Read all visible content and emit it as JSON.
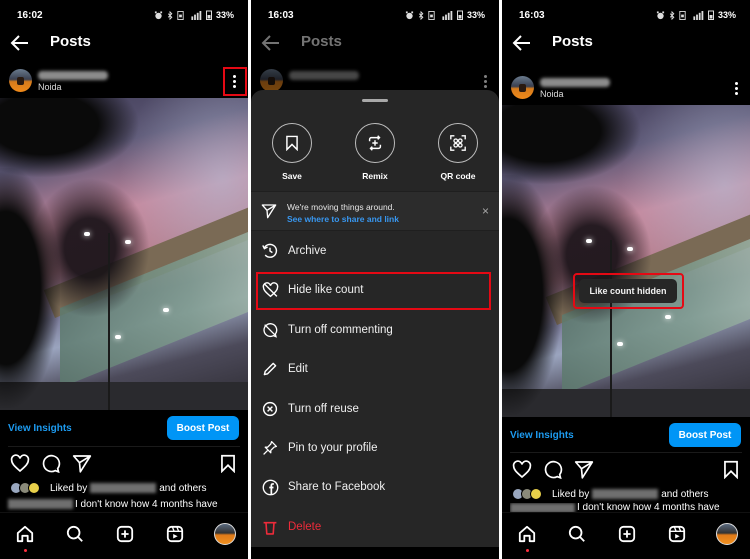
{
  "panels": [
    {
      "status": {
        "time": "16:02",
        "battery": "33%"
      },
      "header": {
        "title": "Posts"
      },
      "post": {
        "location": "Noida"
      },
      "insights": {
        "view_label": "View Insights",
        "boost_label": "Boost Post"
      },
      "liked": {
        "prefix": "Liked by",
        "suffix": "and others"
      },
      "caption": "I don't know how 4 months have"
    },
    {
      "status": {
        "time": "16:03",
        "battery": "33%"
      },
      "header": {
        "title": "Posts"
      },
      "sheet": {
        "quick_actions": [
          {
            "label": "Save",
            "icon": "bookmark-icon"
          },
          {
            "label": "Remix",
            "icon": "remix-icon"
          },
          {
            "label": "QR code",
            "icon": "qr-code-icon"
          }
        ],
        "notice": {
          "text": "We're moving things around.",
          "link": "See where to share and link",
          "close": "×"
        },
        "menu": [
          {
            "label": "Archive",
            "icon": "archive-icon"
          },
          {
            "label": "Hide like count",
            "icon": "hide-like-icon",
            "highlighted": true
          },
          {
            "label": "Turn off commenting",
            "icon": "comment-off-icon"
          },
          {
            "label": "Edit",
            "icon": "pencil-icon"
          },
          {
            "label": "Turn off reuse",
            "icon": "reuse-off-icon"
          },
          {
            "label": "Pin to your profile",
            "icon": "pin-icon"
          },
          {
            "label": "Share to Facebook",
            "icon": "facebook-icon"
          },
          {
            "label": "Delete",
            "icon": "trash-icon",
            "danger": true
          }
        ]
      }
    },
    {
      "status": {
        "time": "16:03",
        "battery": "33%"
      },
      "header": {
        "title": "Posts"
      },
      "post": {
        "location": "Noida"
      },
      "toast": "Like count hidden",
      "insights": {
        "view_label": "View Insights",
        "boost_label": "Boost Post"
      },
      "liked": {
        "prefix": "Liked by",
        "suffix": "and others"
      },
      "caption": "I don't know how 4 months have"
    }
  ],
  "colors": {
    "accent_blue": "#0095f6",
    "link_blue": "#1d9bf0",
    "highlight_red": "#e50914",
    "danger_red": "#ed2b3a",
    "sheet_bg": "#262626"
  }
}
